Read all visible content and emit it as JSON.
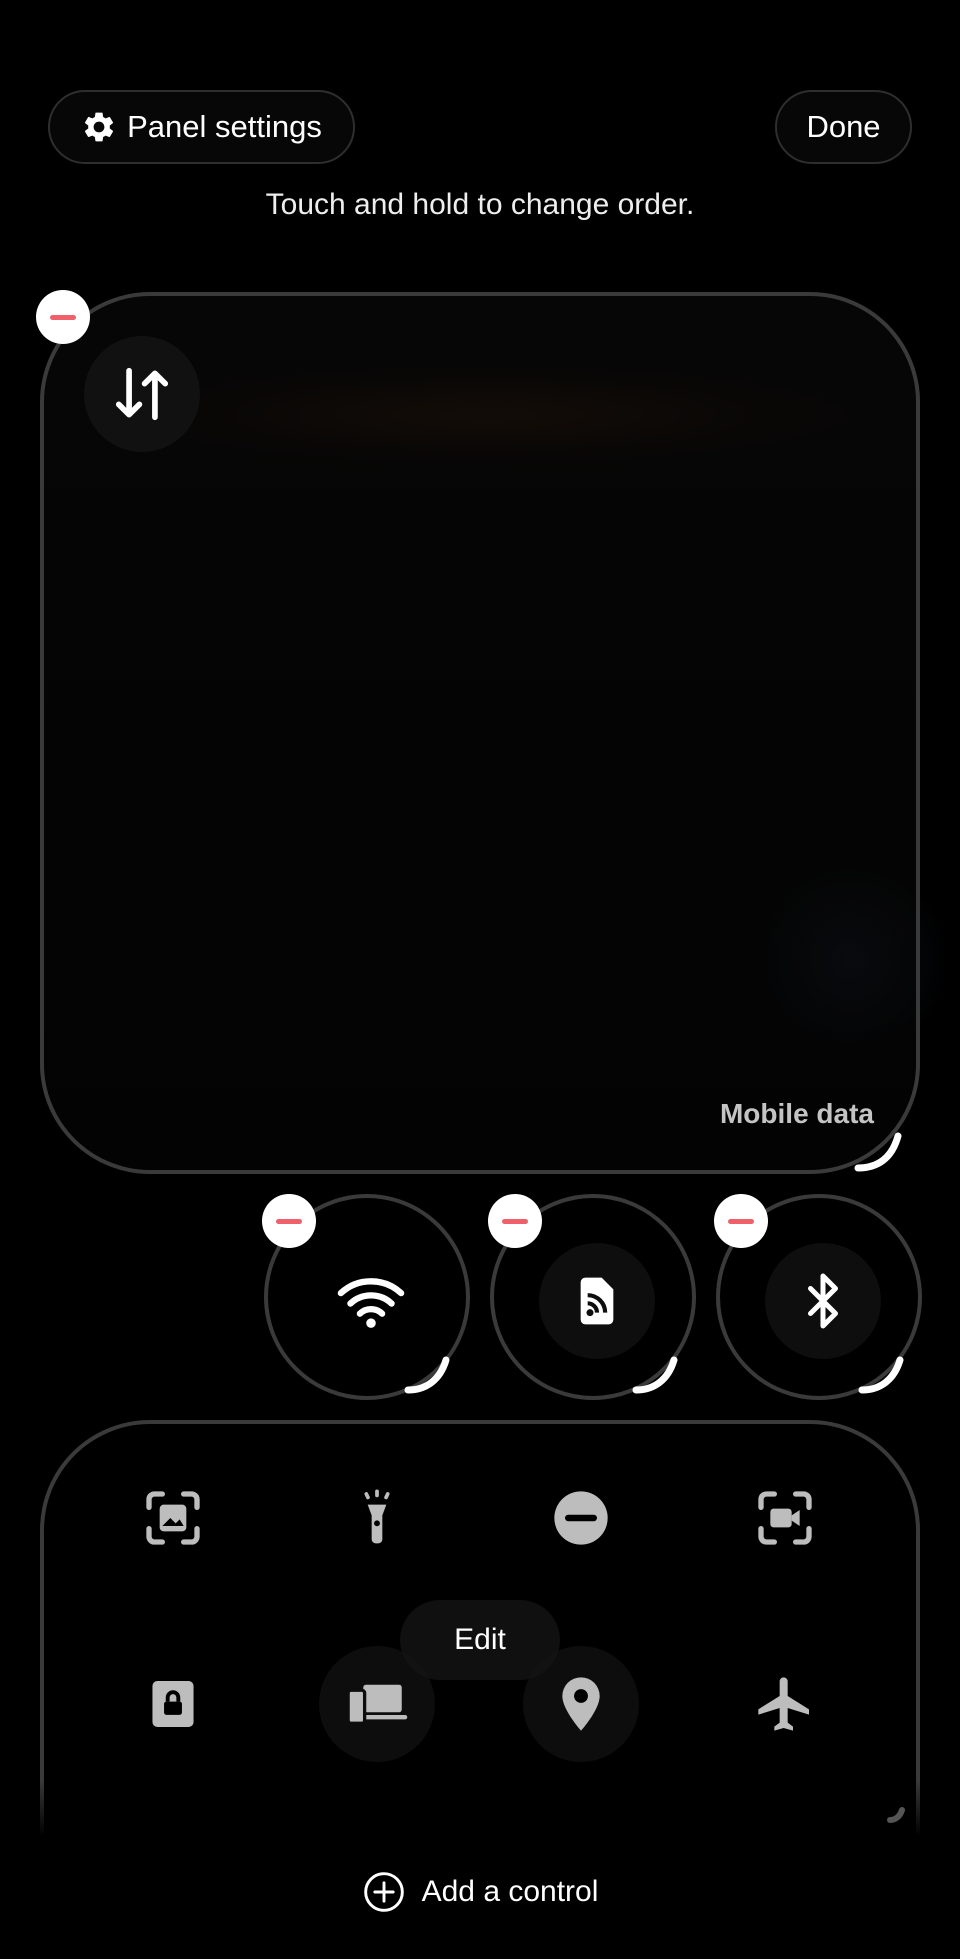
{
  "header": {
    "panel_settings_label": "Panel settings",
    "done_label": "Done",
    "hint_text": "Touch and hold to change order."
  },
  "tiles": {
    "mobile_data": {
      "label": "Mobile data",
      "icon": "data-transfer-icon"
    },
    "round": [
      {
        "icon": "wifi-icon"
      },
      {
        "icon": "cast-icon"
      },
      {
        "icon": "bluetooth-icon"
      }
    ]
  },
  "bottom_panel": {
    "icons": [
      "screenshot-icon",
      "flashlight-icon",
      "do-not-disturb-icon",
      "screen-record-icon",
      "secure-folder-icon",
      "link-to-windows-icon",
      "location-icon",
      "airplane-mode-icon"
    ],
    "edit_label": "Edit"
  },
  "footer": {
    "add_control_label": "Add a control"
  },
  "colors": {
    "background": "#000000",
    "tile_border": "#3a3a3a",
    "minus_red": "#f0606a",
    "icon_gray": "#bdbdbd"
  }
}
